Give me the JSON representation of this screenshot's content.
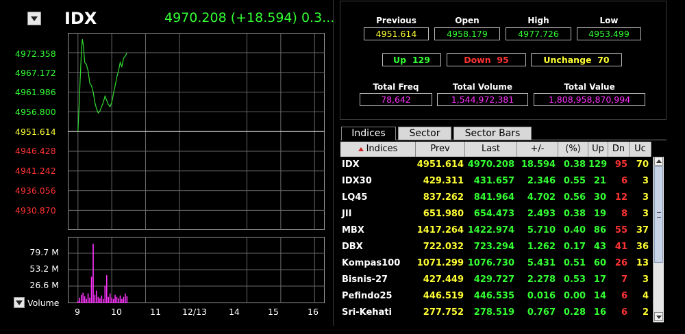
{
  "index_header": {
    "symbol": "IDX",
    "quote": "4970.208 (+18.594) 0.3..."
  },
  "price_chart": {
    "y_labels": [
      {
        "text": "4972.358",
        "color": "#33ff33"
      },
      {
        "text": "4967.172",
        "color": "#33ff33"
      },
      {
        "text": "4961.986",
        "color": "#33ff33"
      },
      {
        "text": "4956.800",
        "color": "#33ff33"
      },
      {
        "text": "4951.614",
        "color": "#ffff33"
      },
      {
        "text": "4946.428",
        "color": "#ff3333"
      },
      {
        "text": "4941.242",
        "color": "#ff3333"
      },
      {
        "text": "4936.056",
        "color": "#ff3333"
      },
      {
        "text": "4930.870",
        "color": "#ff3333"
      }
    ]
  },
  "volume_chart": {
    "y_labels": [
      "79.7 M",
      "53.2 M",
      "26.6 M"
    ],
    "dropdown_label": "Volume"
  },
  "x_labels": [
    "9",
    "10",
    "11",
    "12/13",
    "14",
    "15",
    "16"
  ],
  "chart_data": [
    {
      "type": "line",
      "series": [
        {
          "values": [
            [
              9.0,
              4951.6
            ],
            [
              9.03,
              4957.0
            ],
            [
              9.06,
              4963.0
            ],
            [
              9.1,
              4970.0
            ],
            [
              9.13,
              4973.5
            ],
            [
              9.16,
              4972.0
            ],
            [
              9.2,
              4968.0
            ],
            [
              9.25,
              4967.5
            ],
            [
              9.3,
              4966.0
            ],
            [
              9.35,
              4963.0
            ],
            [
              9.4,
              4962.5
            ],
            [
              9.45,
              4961.0
            ],
            [
              9.5,
              4958.5
            ],
            [
              9.55,
              4957.0
            ],
            [
              9.6,
              4956.0
            ],
            [
              9.65,
              4956.5
            ],
            [
              9.7,
              4957.5
            ],
            [
              9.75,
              4958.5
            ],
            [
              9.8,
              4960.0
            ],
            [
              9.85,
              4959.0
            ],
            [
              9.9,
              4958.0
            ],
            [
              9.95,
              4957.5
            ],
            [
              10.0,
              4958.5
            ],
            [
              10.05,
              4960.5
            ],
            [
              10.1,
              4962.5
            ],
            [
              10.15,
              4964.5
            ],
            [
              10.2,
              4966.0
            ],
            [
              10.25,
              4968.0
            ],
            [
              10.3,
              4967.0
            ],
            [
              10.35,
              4969.0
            ],
            [
              10.4,
              4969.5
            ],
            [
              10.45,
              4970.2
            ]
          ]
        }
      ],
      "ylim": [
        4928.27,
        4975.0
      ],
      "xlim": [
        8.7,
        16.3
      ],
      "reference": 4951.614,
      "color": "#33dd33"
    },
    {
      "type": "bar",
      "series": [
        {
          "values": [
            [
              9.0,
              3
            ],
            [
              9.05,
              8
            ],
            [
              9.1,
              12
            ],
            [
              9.15,
              15
            ],
            [
              9.2,
              10
            ],
            [
              9.25,
              6
            ],
            [
              9.3,
              14
            ],
            [
              9.35,
              8
            ],
            [
              9.4,
              38
            ],
            [
              9.45,
              85
            ],
            [
              9.5,
              12
            ],
            [
              9.55,
              18
            ],
            [
              9.6,
              9
            ],
            [
              9.65,
              7
            ],
            [
              9.7,
              11
            ],
            [
              9.75,
              6
            ],
            [
              9.8,
              25
            ],
            [
              9.85,
              40
            ],
            [
              9.9,
              9
            ],
            [
              9.95,
              14
            ],
            [
              10.0,
              8
            ],
            [
              10.05,
              6
            ],
            [
              10.1,
              12
            ],
            [
              10.15,
              9
            ],
            [
              10.2,
              7
            ],
            [
              10.25,
              11
            ],
            [
              10.3,
              6
            ],
            [
              10.35,
              9
            ],
            [
              10.4,
              14
            ],
            [
              10.45,
              10
            ]
          ]
        }
      ],
      "ylim": [
        0,
        95
      ],
      "color": "#ff33ff"
    }
  ],
  "summary": {
    "previous_label": "Previous",
    "previous_value": "4951.614",
    "open_label": "Open",
    "open_value": "4958.179",
    "high_label": "High",
    "high_value": "4977.726",
    "low_label": "Low",
    "low_value": "4953.499",
    "up_label": "Up",
    "up_value": "129",
    "down_label": "Down",
    "down_value": "95",
    "unchange_label": "Unchange",
    "unchange_value": "70",
    "total_freq_label": "Total Freq",
    "total_freq_value": "78,642",
    "total_volume_label": "Total Volume",
    "total_volume_value": "1,544,972,381",
    "total_value_label": "Total Value",
    "total_value_value": "1,808,958,870,994"
  },
  "tabs": [
    "Indices",
    "Sector",
    "Sector Bars"
  ],
  "table": {
    "sort_icon": "sort-asc-icon",
    "headers": [
      "Indices",
      "Prev",
      "Last",
      "+/-",
      "(%)",
      "Up",
      "Dn",
      "Uc"
    ],
    "rows": [
      [
        "IDX",
        "4951.614",
        "4970.208",
        "18.594",
        "0.38",
        "129",
        "95",
        "70"
      ],
      [
        "IDX30",
        "429.311",
        "431.657",
        "2.346",
        "0.55",
        "21",
        "6",
        "3"
      ],
      [
        "LQ45",
        "837.262",
        "841.964",
        "4.702",
        "0.56",
        "30",
        "12",
        "3"
      ],
      [
        "JII",
        "651.980",
        "654.473",
        "2.493",
        "0.38",
        "19",
        "8",
        "3"
      ],
      [
        "MBX",
        "1417.264",
        "1422.974",
        "5.710",
        "0.40",
        "86",
        "55",
        "37"
      ],
      [
        "DBX",
        "722.032",
        "723.294",
        "1.262",
        "0.17",
        "43",
        "41",
        "36"
      ],
      [
        "Kompas100",
        "1071.299",
        "1076.730",
        "5.431",
        "0.51",
        "60",
        "26",
        "13"
      ],
      [
        "Bisnis-27",
        "427.449",
        "429.727",
        "2.278",
        "0.53",
        "17",
        "7",
        "3"
      ],
      [
        "Pefindo25",
        "446.519",
        "446.535",
        "0.016",
        "0.00",
        "14",
        "6",
        "4"
      ],
      [
        "Sri-Kehati",
        "277.752",
        "278.519",
        "0.767",
        "0.28",
        "16",
        "6",
        "2"
      ]
    ]
  },
  "colors": {
    "green": "#33ff33",
    "yellow": "#ffff33",
    "red": "#ff3333",
    "magenta": "#ff33ff",
    "white": "#ffffff"
  }
}
